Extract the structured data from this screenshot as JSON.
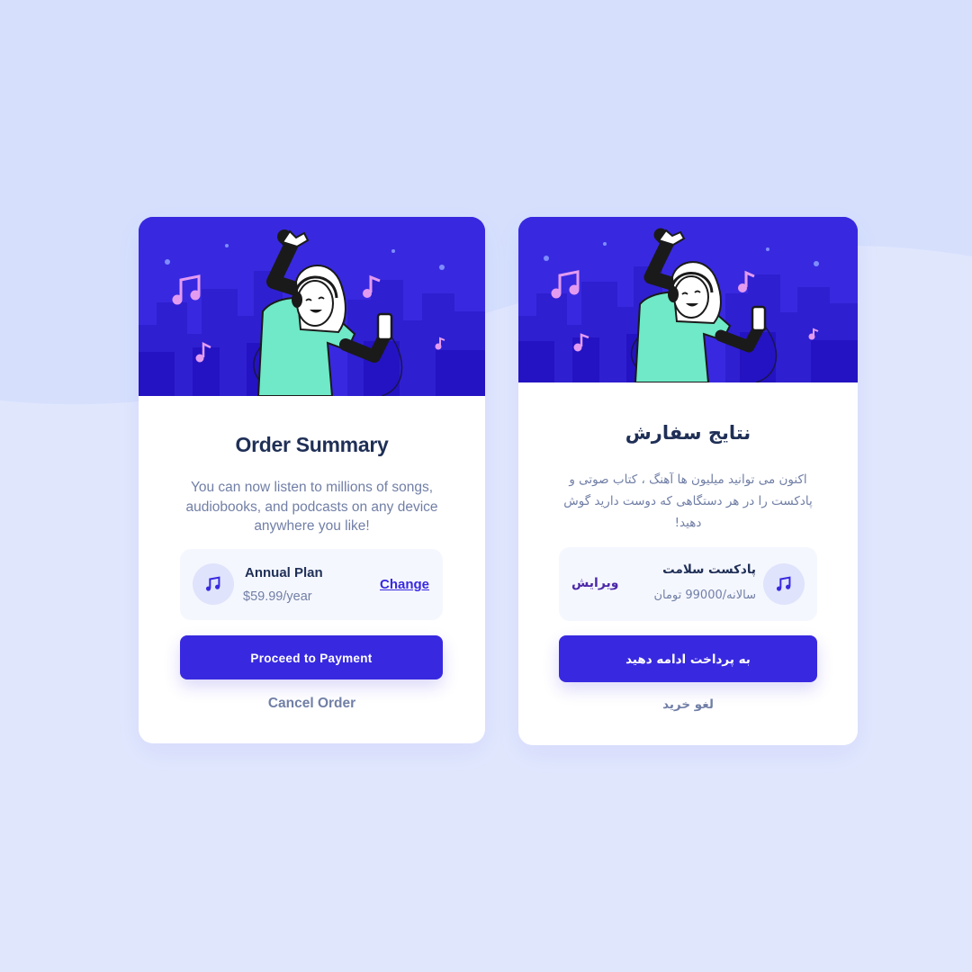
{
  "colors": {
    "background": "#e0e7fd",
    "accent": "#3829e0",
    "hero_bg": "#3829e0",
    "title": "#1f2f56",
    "muted": "#717fa6",
    "plan_bg": "#f5f7ff",
    "rtl_link": "#4c2aa8"
  },
  "cards": [
    {
      "language": "en",
      "title": "Order Summary",
      "description": "You can now listen to millions of songs, audiobooks, and podcasts on any device anywhere you like!",
      "plan": {
        "icon": "music-note-icon",
        "name": "Annual Plan",
        "price": "$59.99/year",
        "change_label": "Change"
      },
      "proceed_label": "Proceed to Payment",
      "cancel_label": "Cancel Order"
    },
    {
      "language": "fa",
      "title": "نتایج سفارش",
      "description": "اکنون می توانید میلیون ها آهنگ ، کتاب صوتی و پادکست را در هر دستگاهی که دوست دارید گوش دهید!",
      "plan": {
        "icon": "music-note-icon",
        "name": "پادکست سلامت",
        "price": "سالانه/99000 تومان",
        "change_label": "ویرایش"
      },
      "proceed_label": "به پرداخت ادامه دهید",
      "cancel_label": "لغو خرید"
    }
  ]
}
